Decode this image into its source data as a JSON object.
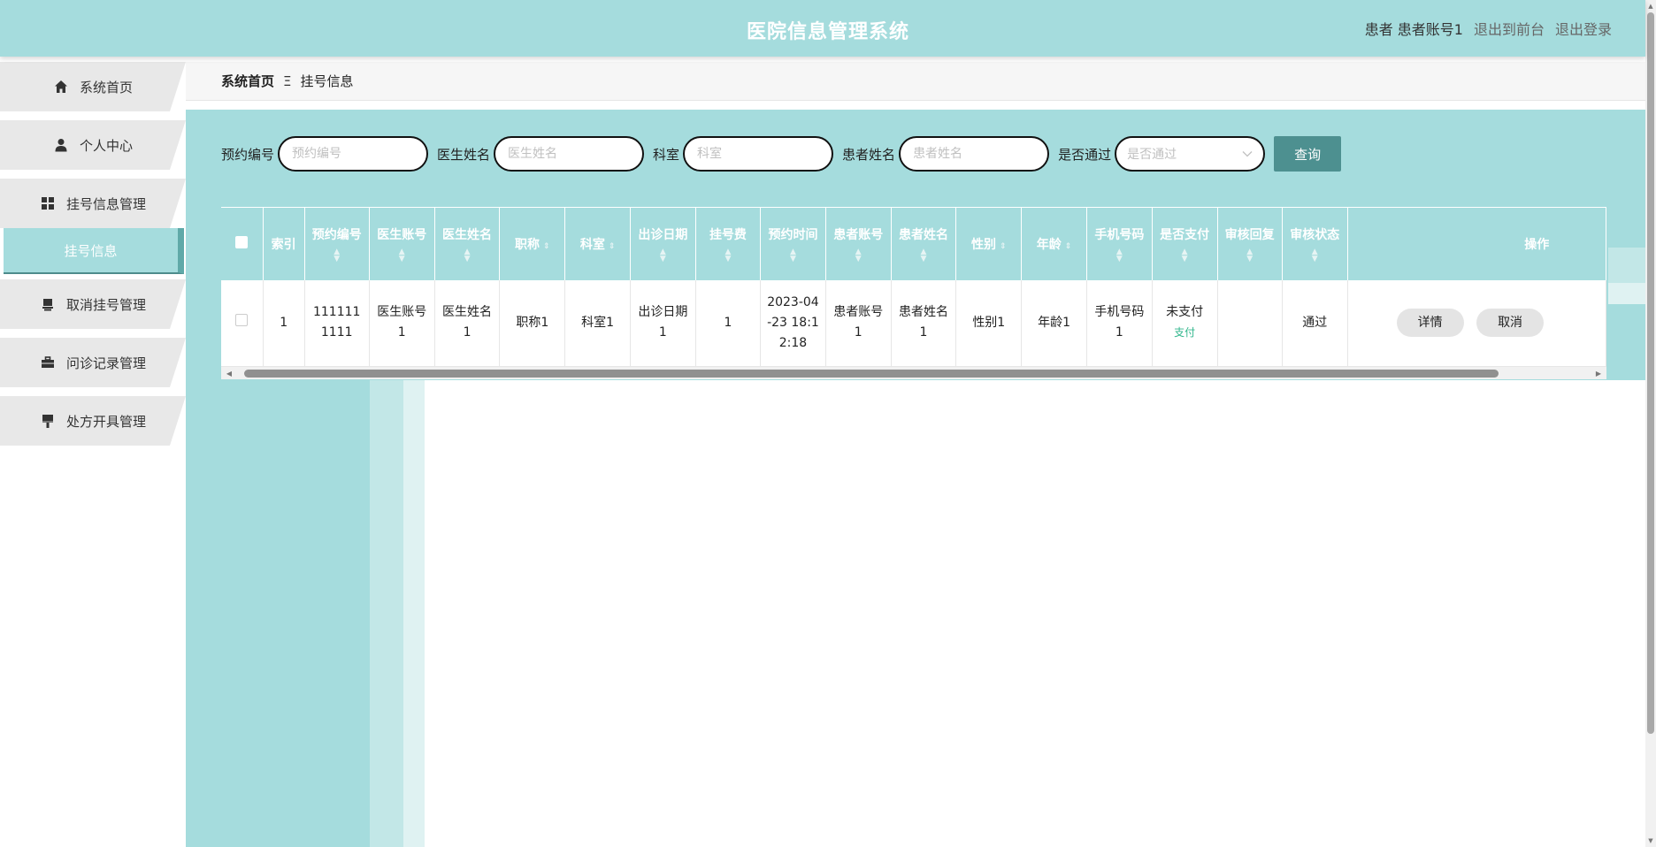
{
  "header": {
    "title": "医院信息管理系统",
    "user": "患者 患者账号1",
    "back_to_front": "退出到前台",
    "logout": "退出登录"
  },
  "sidebar": {
    "items": [
      {
        "label": "系统首页",
        "icon": "home-icon"
      },
      {
        "label": "个人中心",
        "icon": "user-icon"
      },
      {
        "label": "挂号信息管理",
        "icon": "grid-icon"
      },
      {
        "label": "挂号信息",
        "icon": ""
      },
      {
        "label": "取消挂号管理",
        "icon": "stamp-icon"
      },
      {
        "label": "问诊记录管理",
        "icon": "briefcase-icon"
      },
      {
        "label": "处方开具管理",
        "icon": "brush-icon"
      }
    ]
  },
  "breadcrumb": {
    "home": "系统首页",
    "separator": "Ξ",
    "current": "挂号信息"
  },
  "search": {
    "fields": [
      {
        "label": "预约编号",
        "placeholder": "预约编号"
      },
      {
        "label": "医生姓名",
        "placeholder": "医生姓名"
      },
      {
        "label": "科室",
        "placeholder": "科室"
      },
      {
        "label": "患者姓名",
        "placeholder": "患者姓名"
      }
    ],
    "approved_label": "是否通过",
    "approved_placeholder": "是否通过",
    "query_button": "查询"
  },
  "table": {
    "headers": [
      "索引",
      "预约编号",
      "医生账号",
      "医生姓名",
      "职称",
      "科室",
      "出诊日期",
      "挂号费",
      "预约时间",
      "患者账号",
      "患者姓名",
      "性别",
      "年龄",
      "手机号码",
      "是否支付",
      "审核回复",
      "审核状态",
      "操作"
    ],
    "rows": [
      {
        "index": "1",
        "appointment_no": "1111111111",
        "doctor_account": "医生账号1",
        "doctor_name": "医生姓名1",
        "title": "职称1",
        "department": "科室1",
        "visit_date": "出诊日期1",
        "fee": "1",
        "appointment_time": "2023-04-23 18:12:18",
        "patient_account": "患者账号1",
        "patient_name": "患者姓名1",
        "gender": "性别1",
        "age": "年龄1",
        "phone": "手机号码1",
        "paid_status": "未支付",
        "pay_link": "支付",
        "review_reply": "",
        "review_status": "通过",
        "actions": [
          "详情",
          "取消"
        ]
      }
    ]
  },
  "colors": {
    "accent": "#a5dcdd",
    "button": "#4d9090",
    "pay_link": "#2fb68b"
  }
}
